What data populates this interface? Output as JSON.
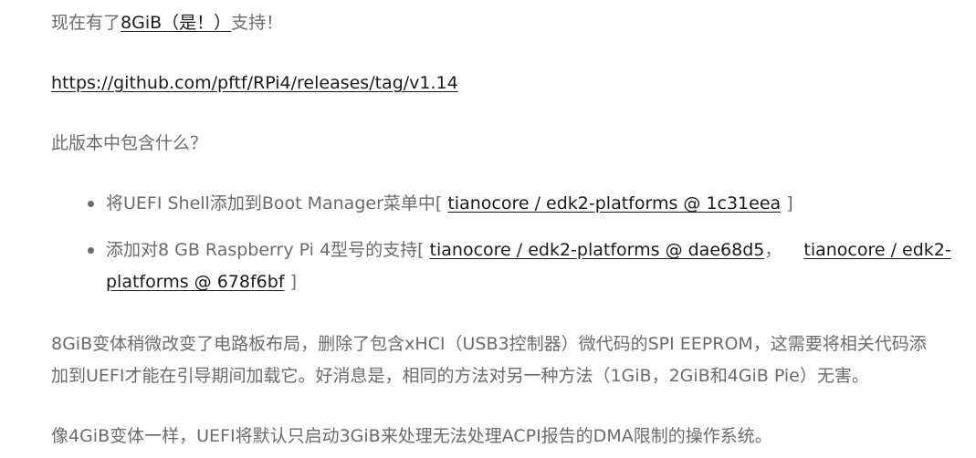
{
  "para1": {
    "prefix": "现在有了",
    "link": "8GiB（是！）",
    "suffix": "支持！"
  },
  "para2": {
    "link": "https://github.com/pftf/RPi4/releases/tag/v1.14"
  },
  "para3": {
    "text": "此版本中包含什么？"
  },
  "list": {
    "item1": {
      "text": "将UEFI Shell添加到Boot Manager菜单中[",
      "link": "tianocore / edk2-platforms @ 1c31eea",
      "close": "]"
    },
    "item2": {
      "text": "添加对8 GB Raspberry Pi 4型号的支持[",
      "link1": "tianocore / edk2-platforms @ dae68d5",
      "sep": "，",
      "link2": "tianocore / edk2-platforms @ 678f6bf",
      "close": "]"
    }
  },
  "para4": {
    "text": "8GiB变体稍微改变了电路板布局，删除了包含xHCI（USB3控制器）微代码的SPI EEPROM，这需要将相关代码添加到UEFI才能在引导期间加载它。好消息是，相同的方法对另一种方法（1GiB，2GiB和4GiB Pie）无害。"
  },
  "para5": {
    "text": "像4GiB变体一样，UEFI将默认只启动3GiB来处理无法处理ACPI报告的DMA限制的操作系统。"
  }
}
